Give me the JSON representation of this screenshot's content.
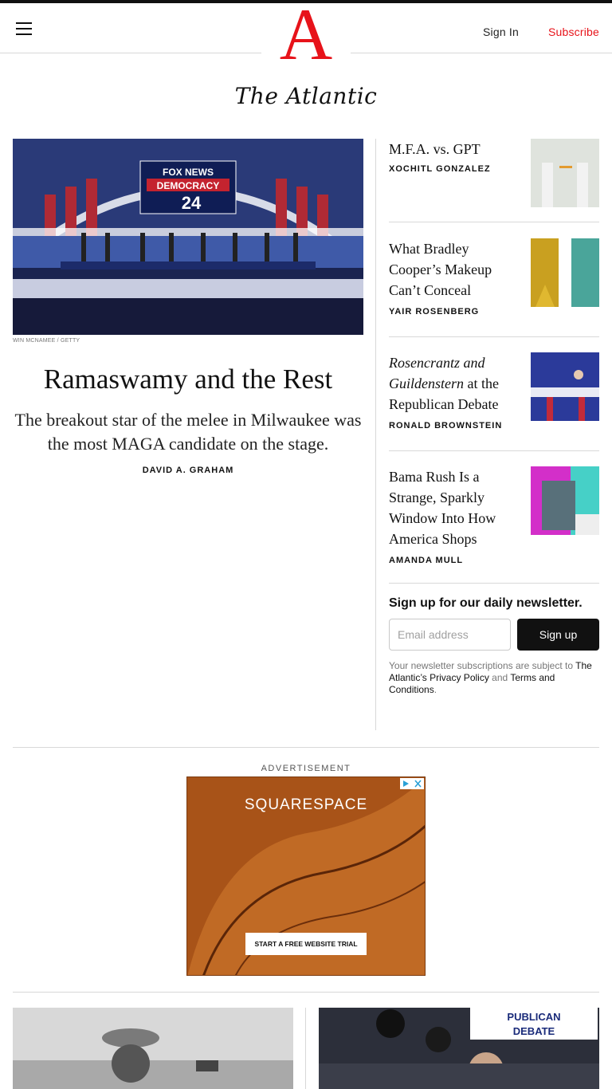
{
  "header": {
    "logo_letter": "A",
    "sign_in": "Sign In",
    "subscribe": "Subscribe",
    "wordmark": "The Atlantic"
  },
  "lead": {
    "image_credit": "WIN MCNAMEE / GETTY",
    "image_screen_lines": [
      "FOX NEWS",
      "DEMOCRACY",
      "24"
    ],
    "title": "Ramaswamy and the Rest",
    "dek": "The breakout star of the melee in Milwaukee was the most MAGA candidate on the stage.",
    "byline": "DAVID A. GRAHAM"
  },
  "stories": [
    {
      "headline": "M.F.A. vs. GPT",
      "byline": "XOCHITL GONZALEZ",
      "thumb": "robot-hands-pencil-image"
    },
    {
      "headline": "What Bradley Cooper’s Makeup Can’t Conceal",
      "byline": "YAIR ROSENBERG",
      "thumb": "split-portrait-image"
    },
    {
      "headline_italic": "Rosencrantz and Guildenstern",
      "headline_rest": " at the Republican Debate",
      "byline": "RONALD BROWNSTEIN",
      "thumb": "debate-stage-image"
    },
    {
      "headline": "Bama Rush Is a Strange, Sparkly Window Into How America Shops",
      "byline": "AMANDA MULL",
      "thumb": "sparkly-bag-image"
    }
  ],
  "newsletter": {
    "title": "Sign up for our daily newsletter.",
    "email_placeholder": "Email address",
    "button": "Sign up",
    "legal_prefix": "Your newsletter subscriptions are subject to ",
    "privacy_link": "The Atlantic’s Privacy Policy",
    "legal_and": " and ",
    "terms_link": "Terms and Conditions",
    "legal_suffix": "."
  },
  "ad": {
    "label": "ADVERTISEMENT",
    "brand": "SQUARESPACE",
    "cta": "START A FREE WEBSITE TRIAL"
  },
  "bottom_images": [
    "soldier-portrait-image",
    "press-scrum-image"
  ],
  "bottom_right_sign": [
    "PUBLICAN",
    "DEBATE"
  ],
  "colors": {
    "brand_red": "#e7131a",
    "text": "#111111",
    "rule": "#d8d8d8"
  }
}
